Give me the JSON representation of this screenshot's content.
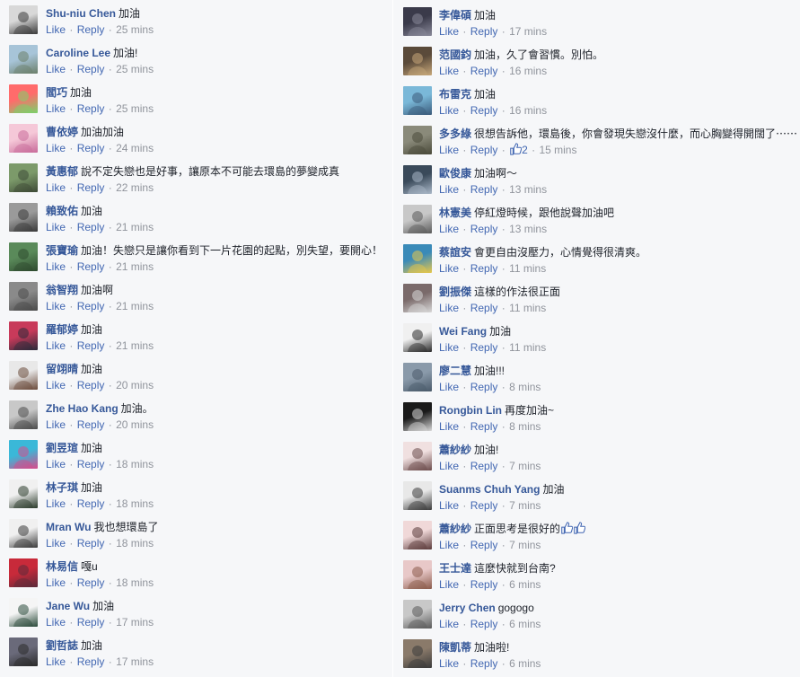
{
  "actions": {
    "like": "Like",
    "reply": "Reply",
    "separator": "·"
  },
  "left_comments": [
    {
      "author": "Shu-niu Chen",
      "text": "加油",
      "time": "25 mins",
      "avatar_colors": [
        "#d8d8d8",
        "#3a3a3a"
      ]
    },
    {
      "author": "Caroline Lee",
      "text": "加油!",
      "time": "25 mins",
      "avatar_colors": [
        "#a7c4d8",
        "#6b7f6a"
      ]
    },
    {
      "author": "閻巧",
      "text": "加油",
      "time": "25 mins",
      "avatar_colors": [
        "#ff6b6b",
        "#7bd36b"
      ]
    },
    {
      "author": "曹依婷",
      "text": "加油加油",
      "time": "24 mins",
      "avatar_colors": [
        "#f5c8d8",
        "#c86b9a"
      ]
    },
    {
      "author": "黃惠郁",
      "text": "說不定失戀也是好事，讓原本不可能去環島的夢變成真",
      "time": "22 mins",
      "avatar_colors": [
        "#7c9a6a",
        "#3d4a36"
      ]
    },
    {
      "author": "賴致佑",
      "text": "加油",
      "time": "21 mins",
      "avatar_colors": [
        "#9a9a9a",
        "#3a3a3a"
      ]
    },
    {
      "author": "張寶瑜",
      "text": "加油！失戀只是讓你看到下一片花園的起點，別失望，要開心！",
      "time": "21 mins",
      "avatar_colors": [
        "#5a8a5a",
        "#2e4a2e"
      ]
    },
    {
      "author": "翁智翔",
      "text": "加油啊",
      "time": "21 mins",
      "avatar_colors": [
        "#8a8a8a",
        "#4a4a4a"
      ]
    },
    {
      "author": "羅郁婷",
      "text": "加油",
      "time": "21 mins",
      "avatar_colors": [
        "#c83a5a",
        "#2a2a3a"
      ]
    },
    {
      "author": "留翊晴",
      "text": "加油",
      "time": "20 mins",
      "avatar_colors": [
        "#e8e8e8",
        "#6a4a3a"
      ]
    },
    {
      "author": "Zhe Hao Kang",
      "text": "加油。",
      "time": "20 mins",
      "avatar_colors": [
        "#c8c8c8",
        "#4a4a4a"
      ]
    },
    {
      "author": "劉昱瑄",
      "text": "加油",
      "time": "18 mins",
      "avatar_colors": [
        "#3ab8d8",
        "#d84a8a"
      ]
    },
    {
      "author": "林子琪",
      "text": "加油",
      "time": "18 mins",
      "avatar_colors": [
        "#f0f0f0",
        "#2a3a2a"
      ]
    },
    {
      "author": "Mran Wu",
      "text": "我也想環島了",
      "time": "18 mins",
      "avatar_colors": [
        "#f0f0f0",
        "#3a3a3a"
      ]
    },
    {
      "author": "林易信",
      "text": "嘎u",
      "time": "18 mins",
      "avatar_colors": [
        "#c82a3a",
        "#5a2a3a"
      ]
    },
    {
      "author": "Jane Wu",
      "text": "加油",
      "time": "17 mins",
      "avatar_colors": [
        "#f5f5f5",
        "#2a4a3a"
      ]
    },
    {
      "author": "劉哲誌",
      "text": "加油",
      "time": "17 mins",
      "avatar_colors": [
        "#6a6a7a",
        "#2a2a2a"
      ]
    }
  ],
  "right_comments": [
    {
      "author": "李偉碩",
      "text": "加油",
      "time": "17 mins",
      "likes": "",
      "avatar_colors": [
        "#3a3a4a",
        "#8a8a9a"
      ]
    },
    {
      "author": "范國鈞",
      "text": "加油，久了會習慣。別怕。",
      "time": "16 mins",
      "likes": "",
      "avatar_colors": [
        "#5a4a3a",
        "#c8a87a"
      ]
    },
    {
      "author": "布雷克",
      "text": "加油",
      "time": "16 mins",
      "likes": "",
      "avatar_colors": [
        "#7ab8d8",
        "#3a5a7a"
      ]
    },
    {
      "author": "多多綠",
      "text": "很想告訴他，環島後，你會發現失戀沒什麼，而心胸變得開闊了⋯⋯",
      "time": "15 mins",
      "likes": "2",
      "avatar_colors": [
        "#8a8a7a",
        "#4a4a3a"
      ]
    },
    {
      "author": "歐俊康",
      "text": "加油啊～",
      "time": "13 mins",
      "likes": "",
      "avatar_colors": [
        "#3a4a5a",
        "#aab8c8"
      ]
    },
    {
      "author": "林憲美",
      "text": "停紅燈時候，跟他說聲加油吧",
      "time": "13 mins",
      "likes": "",
      "avatar_colors": [
        "#c8c8c8",
        "#5a5a5a"
      ]
    },
    {
      "author": "蔡誼安",
      "text": "會更自由沒壓力，心情覺得很清爽。",
      "time": "11 mins",
      "likes": "",
      "avatar_colors": [
        "#3a8ab8",
        "#e8c84a"
      ]
    },
    {
      "author": "劉振傑",
      "text": "這樣的作法很正面",
      "time": "11 mins",
      "likes": "",
      "avatar_colors": [
        "#7a6a6a",
        "#d8d8d8"
      ]
    },
    {
      "author": "Wei Fang",
      "text": "加油",
      "time": "11 mins",
      "likes": "",
      "avatar_colors": [
        "#f0f0f0",
        "#2a2a2a"
      ]
    },
    {
      "author": "廖二慧",
      "text": "加油!!!",
      "time": "8 mins",
      "likes": "",
      "avatar_colors": [
        "#8a9aaa",
        "#4a5a6a"
      ]
    },
    {
      "author": "Rongbin Lin",
      "text": "再度加油~",
      "time": "8 mins",
      "likes": "",
      "avatar_colors": [
        "#1a1a1a",
        "#d8d8d8"
      ]
    },
    {
      "author": "蕭紗紗",
      "text": "加油!",
      "time": "7 mins",
      "likes": "",
      "avatar_colors": [
        "#f0e0e0",
        "#6a4a4a"
      ]
    },
    {
      "author": "Suanms Chuh Yang",
      "text": "加油",
      "time": "7 mins",
      "likes": "",
      "avatar_colors": [
        "#e8e8e8",
        "#3a3a3a"
      ]
    },
    {
      "author": "蕭紗紗",
      "text": "正面思考是很好的",
      "time": "7 mins",
      "likes": "",
      "thumbs": 2,
      "avatar_colors": [
        "#f0d8d8",
        "#5a3a3a"
      ]
    },
    {
      "author": "王士達",
      "text": "這麼快就到台南?",
      "time": "6 mins",
      "likes": "",
      "avatar_colors": [
        "#e8c8c8",
        "#8a5a4a"
      ]
    },
    {
      "author": "Jerry Chen",
      "text": "gogogo",
      "time": "6 mins",
      "likes": "",
      "avatar_colors": [
        "#c8c8c8",
        "#5a5a5a"
      ]
    },
    {
      "author": "陳凱蒂",
      "text": "加油啦!",
      "time": "6 mins",
      "likes": "",
      "avatar_colors": [
        "#8a7a6a",
        "#3a3a3a"
      ]
    }
  ]
}
